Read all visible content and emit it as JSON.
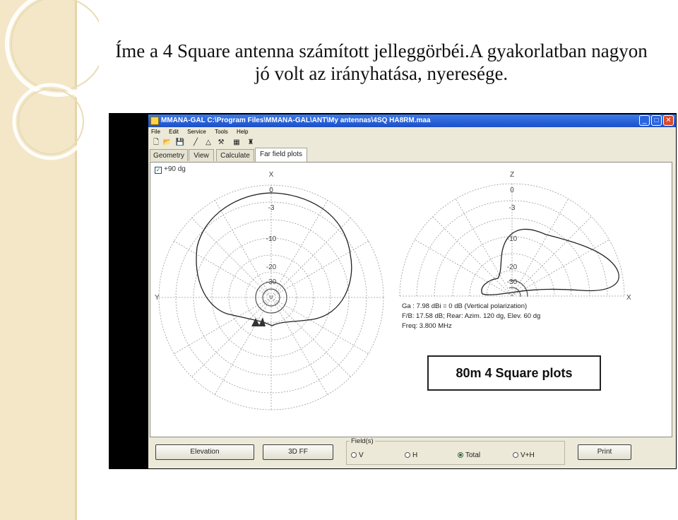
{
  "slide": {
    "title_line1": "Íme a 4 Square antenna számított jelleggörbéi.A gyakorlatban nagyon",
    "title_line2": "jó volt az irányhatása, nyeresége."
  },
  "window": {
    "title": "MMANA-GAL C:\\Program Files\\MMANA-GAL\\ANT\\My antennas\\4SQ HA8RM.maa",
    "controls": {
      "minimize": "_",
      "maximize": "□",
      "close": "✕"
    }
  },
  "menu": [
    "File",
    "Edit",
    "Service",
    "Tools",
    "Help"
  ],
  "toolbar_icons": [
    "new-file-icon",
    "open-folder-icon",
    "save-icon",
    "pencil-icon",
    "triangle-icon",
    "tools-icon",
    "calculator-icon",
    "optimizer-icon"
  ],
  "toolbar_glyphs": [
    "🗋",
    "📂",
    "💾",
    "╱",
    "△",
    "⚒",
    "▦",
    "♜"
  ],
  "tabs": [
    {
      "label": "Geometry"
    },
    {
      "label": "View"
    },
    {
      "label": "Calculate"
    },
    {
      "label": "Far field plots",
      "active": true
    }
  ],
  "checkbox": {
    "label": "+90 dg",
    "checked": true
  },
  "plots": {
    "left": {
      "top_axis": "X",
      "side_axis": "Y",
      "ring_labels": [
        "0",
        "-3",
        "-10",
        "-20",
        "-30"
      ]
    },
    "right": {
      "top_axis": "Z",
      "side_axis": "X",
      "ring_labels": [
        "0",
        "-3",
        "-10",
        "-20",
        "-30"
      ]
    }
  },
  "info": {
    "ga": "Ga : 7.98 dBi = 0 dB  (Vertical polarization)",
    "fb": "F/B: 17.58 dB; Rear:  Azim.  120 dg,   Elev.  60 dg",
    "freq": "Freq: 3.800 MHz"
  },
  "caption": "80m 4 Square plots",
  "buttons": {
    "elevation": "Elevation",
    "ff3d": "3D FF",
    "print": "Print"
  },
  "fields": {
    "legend": "Field(s)",
    "options": [
      "V",
      "H",
      "Total",
      "V+H"
    ],
    "selected": "Total"
  },
  "colors": {
    "slide_strip": "#f3e7c8",
    "titlebar": "#1b4fc9",
    "pattern_line": "#222222",
    "grid": "#9a9a9a"
  }
}
